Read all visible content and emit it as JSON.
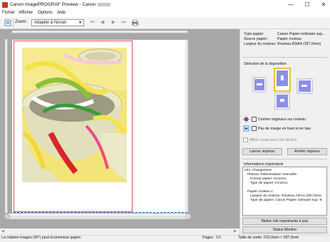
{
  "window": {
    "title": "Canon imagePROGRAF Preview - Canon",
    "minimize_glyph": "—",
    "maximize_glyph": "☐",
    "close_glyph": "✕"
  },
  "menu": [
    "Fichier",
    "Afficher",
    "Options",
    "Aide"
  ],
  "toolbar": {
    "zoom_label": "Zoom:",
    "zoom_value": "Adapter à l'écran",
    "icons": [
      "page-layout-icon",
      "first-page-icon",
      "previous-page-icon",
      "next-page-icon",
      "last-page-icon",
      "print-settings-icon"
    ]
  },
  "paper_info": [
    {
      "key": "Type papier:",
      "value": "Canon Papier ordinaire sup..."
    },
    {
      "key": "Source papier:",
      "value": "Papier rouleau"
    },
    {
      "key": "Largeur du rouleau:",
      "value": "Rouleau A3/A4 (297,0mm)"
    }
  ],
  "layout": {
    "title": "Sélection de la disposition"
  },
  "options": {
    "center_label": "Centrer originaux sur rouleau",
    "no_margin_label": "Pas de marge en haut et en bas",
    "blank_label": "Affich zones avec ton de fluo",
    "center_checked": false,
    "no_margin_checked": false
  },
  "buttons": {
    "print": "Lancer impress",
    "stop": "Arrêter impress",
    "update_info": "Mettre info imprimante à jour",
    "status_monitor": "Status Monitor"
  },
  "printer_info": {
    "title": "Informations imprimante",
    "lines": [
      "Info. Chargement",
      "Plateau d'alimentation manuelle",
      "Format papier: Inconnu",
      "Type de papier: Inconnu",
      "",
      "Papier rouleau 1",
      "Largeur du rouleau: Rouleau A3/A4 (297,0mm",
      "Type de papier: Canon Papier ordinaire sup. B"
    ]
  },
  "status": {
    "message": "La rotation images (90°) peut économiser papier.",
    "pages": "Pages : 1/1",
    "output_size": "Taille de sortie :210,0mm × 297,0mm"
  },
  "colors": {
    "accent_blue": "#2b6fd6",
    "print_area_red": "#e25050",
    "layout_selected": "#e8b400"
  }
}
